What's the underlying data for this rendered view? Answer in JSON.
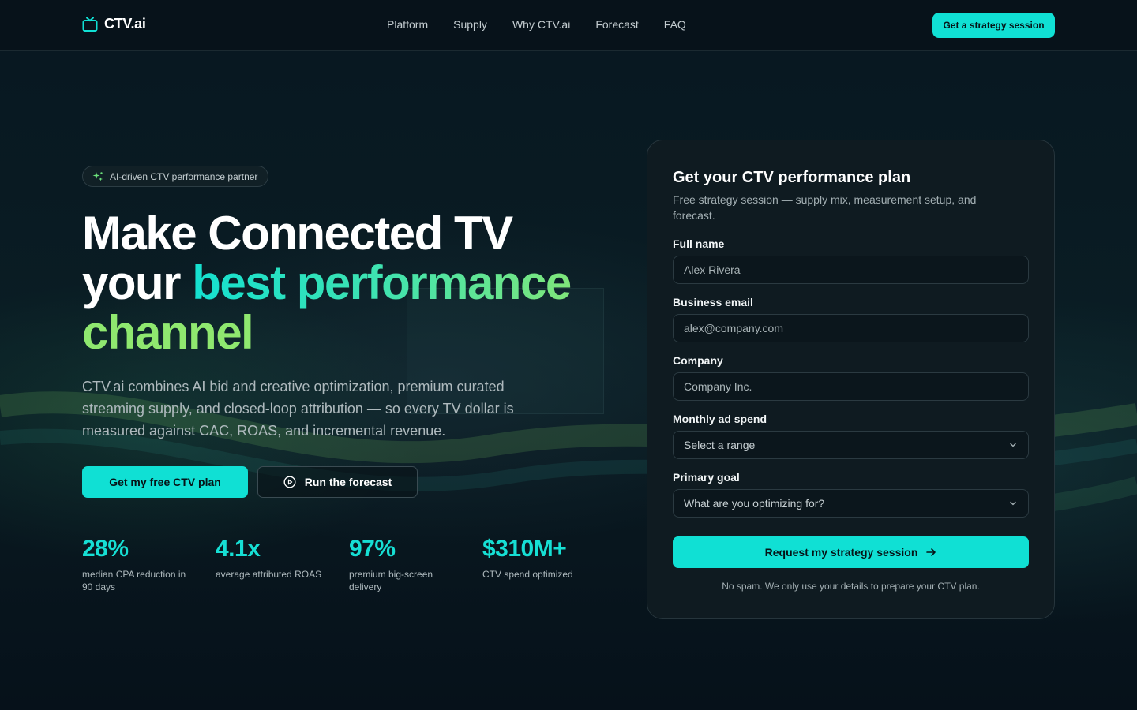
{
  "brand": {
    "name": "CTV.ai",
    "accent": "#10e0d4"
  },
  "nav": {
    "items": [
      "Platform",
      "Supply",
      "Why CTV.ai",
      "Forecast",
      "FAQ"
    ],
    "cta": "Get a strategy session"
  },
  "hero": {
    "badge": "AI-driven CTV performance partner",
    "title_line1": "Make Connected TV",
    "title_line2_plain": "your ",
    "title_line2_accent": "best performance",
    "title_line3": "channel",
    "subtitle": "CTV.ai combines AI bid and creative optimization, premium curated streaming supply, and closed-loop attribution — so every TV dollar is measured against CAC, ROAS, and incremental revenue.",
    "primary_button": "Get my free CTV plan",
    "secondary_button": "Run the forecast",
    "stats": [
      {
        "value": "28%",
        "label": "median CPA reduction in 90 days"
      },
      {
        "value": "4.1x",
        "label": "average attributed ROAS"
      },
      {
        "value": "97%",
        "label": "premium big-screen delivery"
      },
      {
        "value": "$310M+",
        "label": "CTV spend optimized"
      }
    ]
  },
  "form": {
    "title": "Get your CTV performance plan",
    "subtitle": "Free strategy session — supply mix, measurement setup, and forecast.",
    "fields": [
      {
        "label": "Full name",
        "placeholder": "Alex Rivera"
      },
      {
        "label": "Business email",
        "placeholder": "alex@company.com"
      },
      {
        "label": "Company",
        "placeholder": "Company Inc."
      },
      {
        "label": "Monthly ad spend",
        "value": "Select a range"
      },
      {
        "label": "Primary goal",
        "value": "What are you optimizing for?"
      }
    ],
    "submit": "Request my strategy session",
    "disclaimer": "No spam. We only use your details to prepare your CTV plan."
  }
}
